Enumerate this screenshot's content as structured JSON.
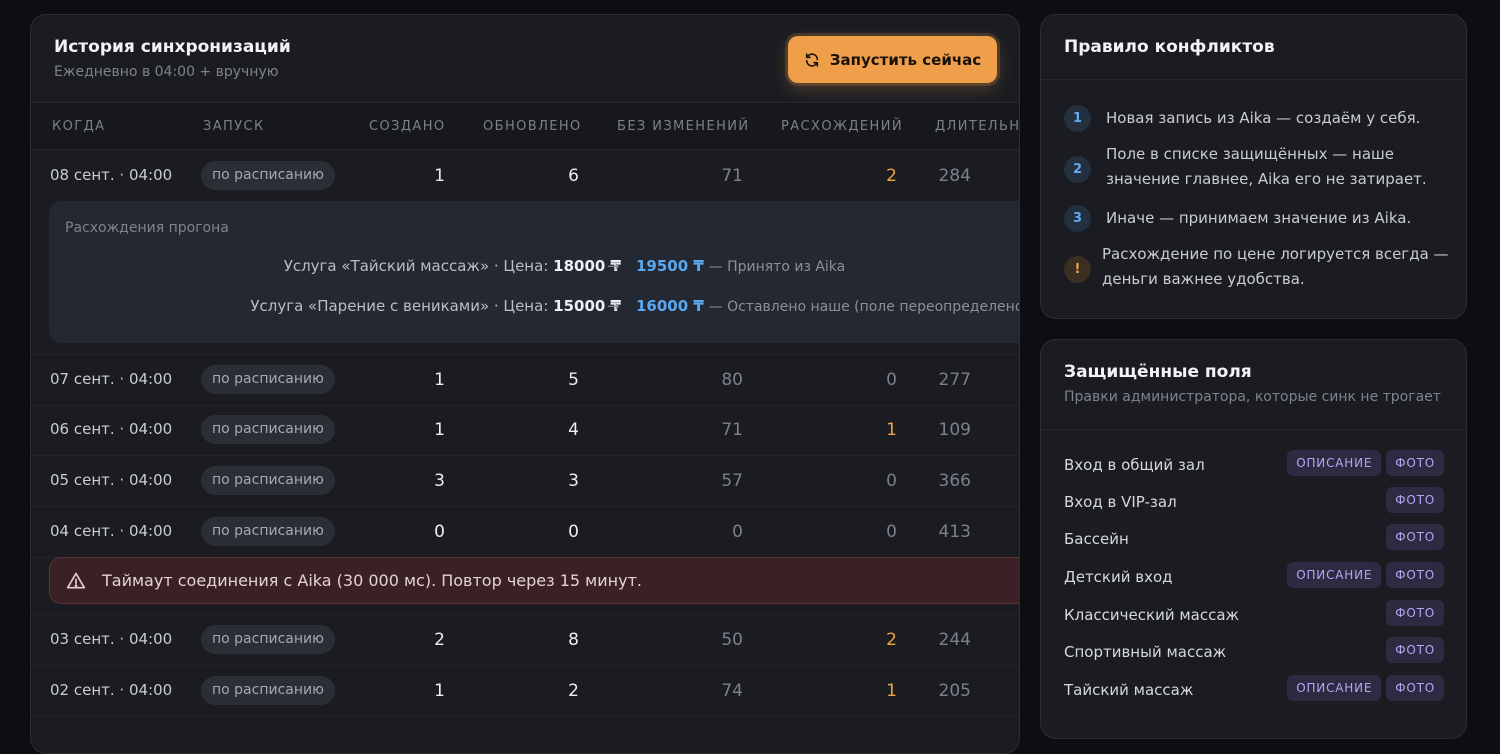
{
  "history": {
    "title": "История синхронизаций",
    "subtitle": "Ежедневно в 04:00 + вручную",
    "run_button": "Запустить сейчас",
    "columns": [
      "КОГДА",
      "ЗАПУСК",
      "СОЗДАНО",
      "ОБНОВЛЕНО",
      "БЕЗ ИЗМЕНЕНИЙ",
      "РАСХОЖДЕНИЙ",
      "ДЛИТЕЛЬНОСТЬ"
    ],
    "rows": [
      {
        "when": "08 сент. · 04:00",
        "trigger": "по расписанию",
        "created": "1",
        "updated": "6",
        "unchanged": "71",
        "diffs": "2",
        "duration": "284"
      },
      {
        "when": "07 сент. · 04:00",
        "trigger": "по расписанию",
        "created": "1",
        "updated": "5",
        "unchanged": "80",
        "diffs": "0",
        "duration": "277"
      },
      {
        "when": "06 сент. · 04:00",
        "trigger": "по расписанию",
        "created": "1",
        "updated": "4",
        "unchanged": "71",
        "diffs": "1",
        "duration": "109"
      },
      {
        "when": "05 сент. · 04:00",
        "trigger": "по расписанию",
        "created": "3",
        "updated": "3",
        "unchanged": "57",
        "diffs": "0",
        "duration": "366"
      },
      {
        "when": "04 сент. · 04:00",
        "trigger": "по расписанию",
        "created": "0",
        "updated": "0",
        "unchanged": "0",
        "diffs": "0",
        "duration": "413"
      },
      {
        "when": "03 сент. · 04:00",
        "trigger": "по расписанию",
        "created": "2",
        "updated": "8",
        "unchanged": "50",
        "diffs": "2",
        "duration": "244"
      },
      {
        "when": "02 сент. · 04:00",
        "trigger": "по расписанию",
        "created": "1",
        "updated": "2",
        "unchanged": "74",
        "diffs": "1",
        "duration": "205"
      }
    ],
    "diff_panel": {
      "title": "Расхождения прогона",
      "items": [
        {
          "label": "Услуга «Тайский массаж» · Цена:",
          "old": "18000 ₸",
          "arrow": "→",
          "new": "19500 ₸",
          "note": "— Принято из Aika"
        },
        {
          "label": "Услуга «Парение с вениками» · Цена:",
          "old": "15000 ₸",
          "arrow": "→",
          "new": "16000 ₸",
          "note": "— Оставлено наше (поле переопределено вр"
        }
      ]
    },
    "alert": "Таймаут соединения с Aika (30 000 мс). Повтор через 15 минут."
  },
  "rules": {
    "title": "Правило конфликтов",
    "items": [
      {
        "marker": "1",
        "text": "Новая запись из Aika — создаём у себя."
      },
      {
        "marker": "2",
        "text": "Поле в списке защищённых — наше значение главнее, Aika его не затирает."
      },
      {
        "marker": "3",
        "text": "Иначе — принимаем значение из Aika."
      },
      {
        "marker": "!",
        "text": "Расхождение по цене логируется всегда — деньги важнее удобства."
      }
    ]
  },
  "protected": {
    "title": "Защищённые поля",
    "subtitle": "Правки администратора, которые синк не трогает",
    "items": [
      {
        "name": "Вход в общий зал",
        "tags": [
          "ОПИСАНИЕ",
          "ФОТО"
        ]
      },
      {
        "name": "Вход в VIP-зал",
        "tags": [
          "ФОТО"
        ]
      },
      {
        "name": "Бассейн",
        "tags": [
          "ФОТО"
        ]
      },
      {
        "name": "Детский вход",
        "tags": [
          "ОПИСАНИЕ",
          "ФОТО"
        ]
      },
      {
        "name": "Классический массаж",
        "tags": [
          "ФОТО"
        ]
      },
      {
        "name": "Спортивный массаж",
        "tags": [
          "ФОТО"
        ]
      },
      {
        "name": "Тайский массаж",
        "tags": [
          "ОПИСАНИЕ",
          "ФОТО"
        ]
      }
    ]
  },
  "colors": {
    "accent": "#ef9f4a",
    "warning": "#f0a640",
    "link": "#5aa9f0",
    "tag_text": "#b6a5f5"
  }
}
